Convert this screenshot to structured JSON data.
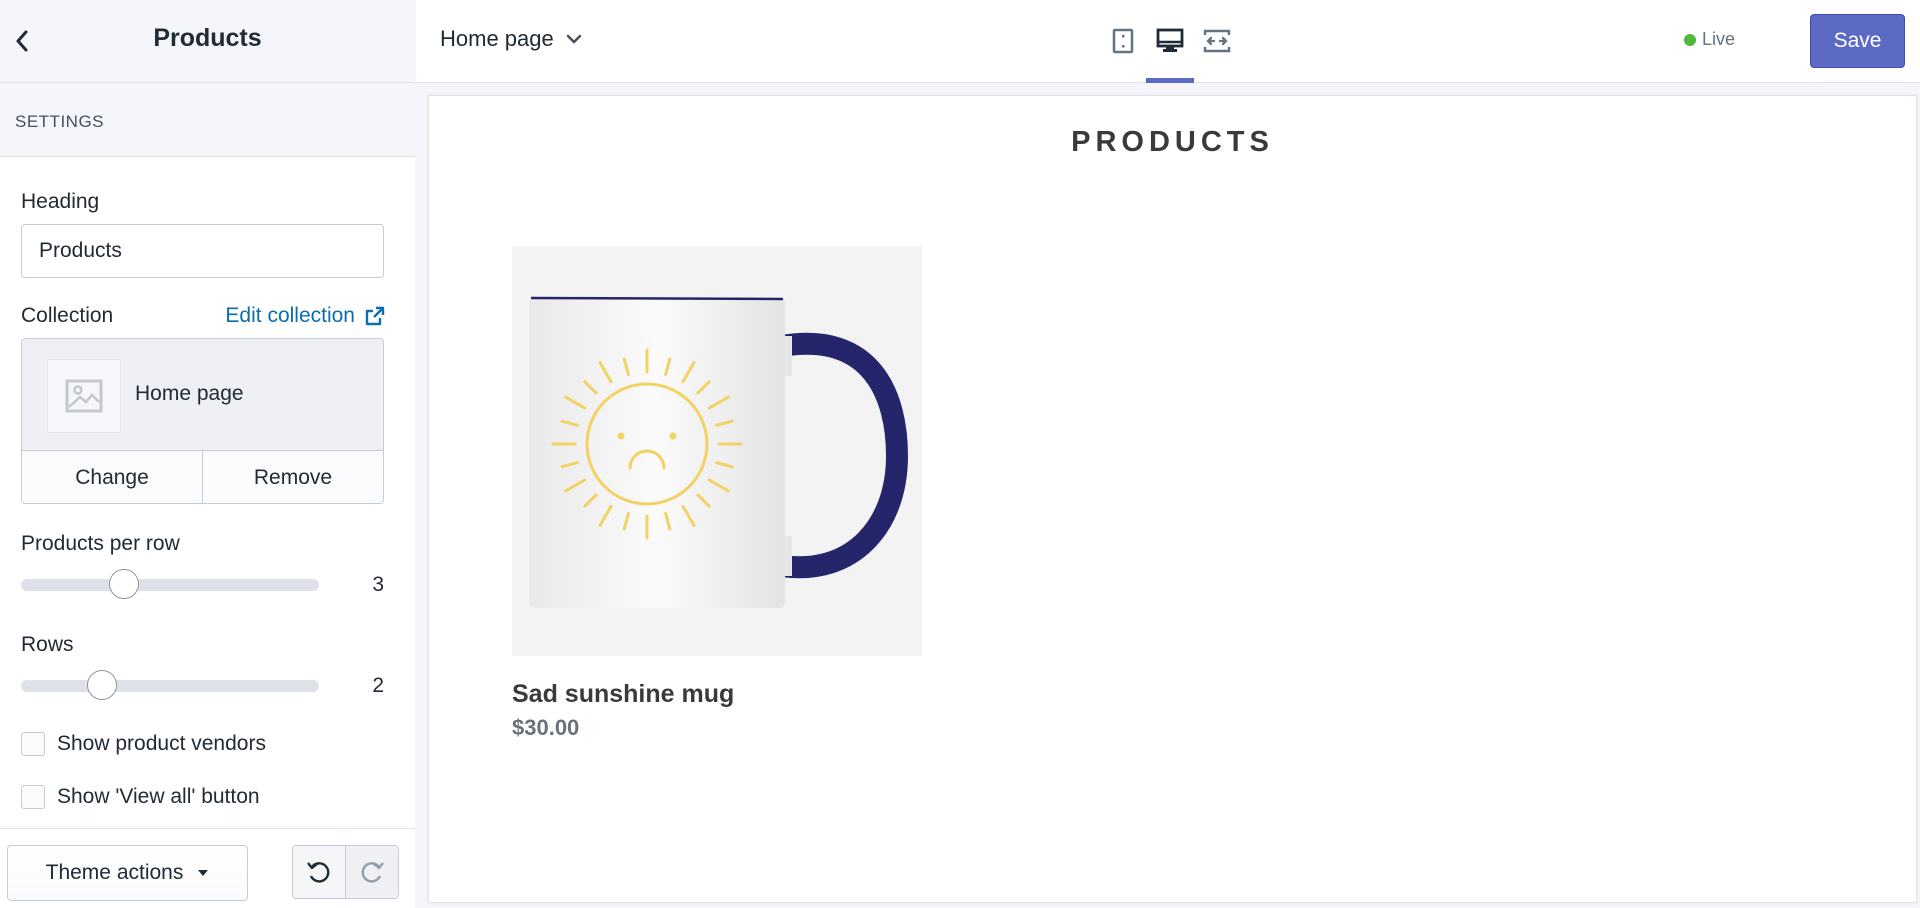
{
  "sidebar": {
    "title": "Products",
    "section_label": "SETTINGS",
    "heading_label": "Heading",
    "heading_value": "Products",
    "collection_label": "Collection",
    "edit_collection_link": "Edit collection",
    "collection_name": "Home page",
    "change_button": "Change",
    "remove_button": "Remove",
    "products_per_row_label": "Products per row",
    "products_per_row_value": "3",
    "rows_label": "Rows",
    "rows_value": "2",
    "show_vendors_label": "Show product vendors",
    "show_vendors_checked": false,
    "show_view_all_label": "Show 'View all' button",
    "show_view_all_checked": false
  },
  "footer": {
    "theme_actions_label": "Theme actions"
  },
  "topbar": {
    "page_selector": "Home page",
    "devices": [
      "mobile-icon",
      "desktop-icon",
      "full-width-icon"
    ],
    "active_device": "desktop",
    "status_label": "Live",
    "save_label": "Save"
  },
  "colors": {
    "accent": "#5c6ac4",
    "link": "#0b6ead",
    "live": "#50b83c",
    "mug_handle": "#25256b",
    "sun": "#f3d264"
  },
  "preview": {
    "heading": "PRODUCTS",
    "products": [
      {
        "title": "Sad sunshine mug",
        "price": "$30.00"
      }
    ]
  }
}
